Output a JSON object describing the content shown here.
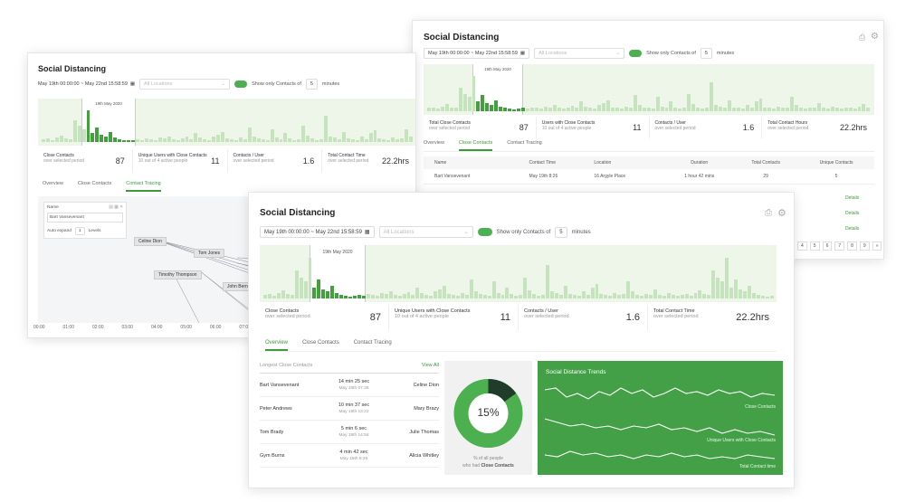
{
  "app": {
    "title": "Social Distancing"
  },
  "controls": {
    "date_range": "May 19th 00:00:00 ~ May 22nd 15:58:59",
    "date_range_short": "May 19th 00:00:00 ~ May 22nd 15:58:59",
    "location_placeholder": "All Locations",
    "toggle_label": "Show only Contacts of",
    "distance_value": "5",
    "minutes_label": "minutes",
    "selected_day": "19th May 2020"
  },
  "stats": [
    {
      "label": "Close Contacts",
      "sub": "over selected period",
      "value": "87"
    },
    {
      "label": "Unique Users with Close Contacts",
      "sub": "10 out of 4 active people",
      "value": "11"
    },
    {
      "label": "Contacts / User",
      "sub": "over selected period",
      "value": "1.6"
    },
    {
      "label": "Total Contact Time",
      "sub": "over selected period",
      "value": "22.2hrs"
    }
  ],
  "stats_back": [
    {
      "label": "Total Close Contacts",
      "sub": "over selected period",
      "value": "87"
    },
    {
      "label": "Users with Close Contacts",
      "sub": "10 out of 4 active people",
      "value": "11"
    },
    {
      "label": "Contacts / User",
      "sub": "over selected period",
      "value": "1.6"
    },
    {
      "label": "Total Contact Hours",
      "sub": "over selected period",
      "value": "22.2hrs"
    }
  ],
  "tabs": [
    "Overview",
    "Close Contacts",
    "Contact Tracing"
  ],
  "left_panel": {
    "name_label": "Name",
    "name_value": "Bart Vansevenant",
    "auto_expand_label": "Auto expand",
    "auto_expand_value": "1",
    "levels_label": "Levels",
    "nodes": [
      "Celine Dion",
      "Tom Jones",
      "Timothy Thompson",
      "John Berns"
    ],
    "time_ticks": [
      "00:00",
      "01:00",
      "02:00",
      "03:00",
      "04:00",
      "05:00",
      "06:00",
      "07:00"
    ]
  },
  "right_panel": {
    "columns": [
      "Name",
      "Contact Time",
      "Location",
      "Duration",
      "Total Contacts",
      "Unique Contacts"
    ],
    "row": {
      "name": "Bart Vansevenant",
      "time": "May 19th 8:26",
      "location": "16 Argyle Place",
      "duration": "1 hour 42 mins",
      "total": "29",
      "unique": "5"
    },
    "detail_label": "Details",
    "pages": [
      "4",
      "5",
      "6",
      "7",
      "8",
      "9",
      "»"
    ]
  },
  "overview": {
    "longest_title": "Longest Close Contacts",
    "view_all": "View All",
    "contacts": [
      {
        "a": "Bart Vansevenant",
        "dur": "14 min 25 sec",
        "date": "May 19th 07:36",
        "b": "Celine Dion"
      },
      {
        "a": "Peter Andrews",
        "dur": "10 min 37 sec",
        "date": "May 19th 13:22",
        "b": "Mary Brazy"
      },
      {
        "a": "Tom Brady",
        "dur": "5 min 6 sec",
        "date": "May 19th 14:56",
        "b": "Julie Thomas"
      },
      {
        "a": "Gym Burns",
        "dur": "4 min 42 sec",
        "date": "May 15th 8:26",
        "b": "Alicia Whitley"
      }
    ],
    "donut_value": "15%",
    "donut_pct": 15,
    "donut_caption_1": "% of all people",
    "donut_caption_2": "who had",
    "donut_caption_bold": "Close Contacts",
    "trends_title": "Social Distance Trends",
    "trend_labels": [
      "Close Contacts",
      "Unique Users with Close Contacts",
      "Total Contact time"
    ]
  },
  "colors": {
    "accent": "#3c9a38",
    "trend_bg": "#43a047",
    "donut_light": "#4caf50",
    "donut_dark": "#1f3d2a"
  }
}
